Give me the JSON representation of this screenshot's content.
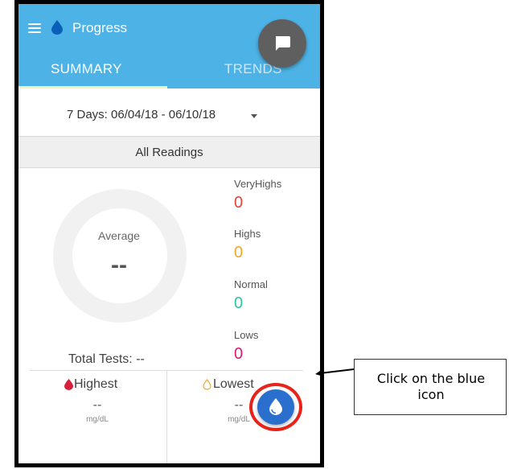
{
  "app": {
    "title": "Progress",
    "menu_icon": "hamburger-menu-icon",
    "logo_icon": "blood-drop-icon"
  },
  "tabs": [
    {
      "label": "SUMMARY",
      "active": true
    },
    {
      "label": "TRENDS",
      "active": false
    }
  ],
  "chat_button": {
    "icon": "chat-bubble-icon"
  },
  "date_range": {
    "label": "7 Days: 06/04/18 - 06/10/18"
  },
  "readings_filter": {
    "label": "All Readings"
  },
  "average": {
    "label": "Average",
    "value": "--"
  },
  "total_tests": {
    "label": "Total Tests: --"
  },
  "stats": [
    {
      "label": "VeryHighs",
      "value": "0",
      "color": "#e5433a"
    },
    {
      "label": "Highs",
      "value": "0",
      "color": "#f5a623"
    },
    {
      "label": "Normal",
      "value": "0",
      "color": "#2ec4a0"
    },
    {
      "label": "Lows",
      "value": "0",
      "color": "#e0187a"
    }
  ],
  "highest": {
    "label": "Highest",
    "value": "--",
    "unit": "mg/dL",
    "icon": "red-drop-icon"
  },
  "lowest": {
    "label": "Lowest",
    "value": "--",
    "unit": "mg/dL",
    "icon": "outline-drop-icon"
  },
  "add_reading_button": {
    "icon": "blood-drop-icon"
  },
  "callout": {
    "text": "Click on the blue icon"
  },
  "colors": {
    "app_bar": "#4db3e6",
    "fab_blue": "#2a6fce",
    "highlight_ring": "#e8231a"
  }
}
